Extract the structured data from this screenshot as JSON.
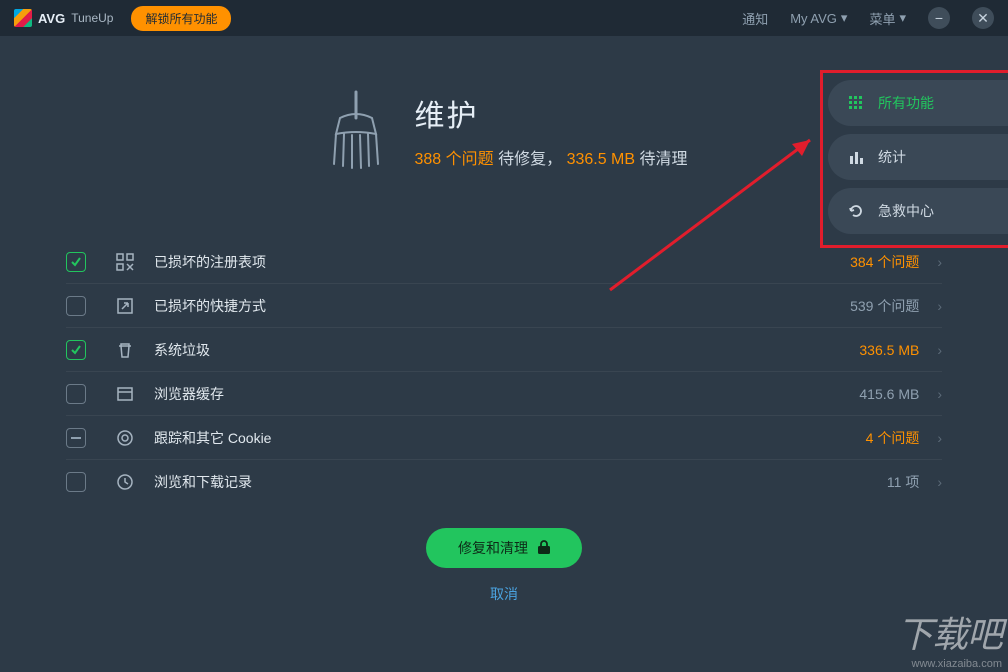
{
  "titlebar": {
    "brand": "AVG",
    "product": "TuneUp",
    "unlock": "解锁所有功能",
    "notify": "通知",
    "myavg": "My AVG",
    "menu": "菜单"
  },
  "hero": {
    "title": "维护",
    "count": "388",
    "count_suffix": "个问题",
    "text1": "待修复，",
    "size": "336.5 MB",
    "text2": "待清理"
  },
  "panel": {
    "all_features": "所有功能",
    "stats": "统计",
    "rescue": "急救中心"
  },
  "rows": [
    {
      "checked": "on",
      "icon": "registry",
      "label": "已损坏的注册表项",
      "val": "384 个问题",
      "hi": true
    },
    {
      "checked": "",
      "icon": "shortcut",
      "label": "已损坏的快捷方式",
      "val": "539 个问题",
      "hi": false
    },
    {
      "checked": "on",
      "icon": "trash",
      "label": "系统垃圾",
      "val": "336.5 MB",
      "hi": true
    },
    {
      "checked": "",
      "icon": "browser",
      "label": "浏览器缓存",
      "val": "415.6 MB",
      "hi": false
    },
    {
      "checked": "partial",
      "icon": "cookie",
      "label": "跟踪和其它 Cookie",
      "val": "4 个问题",
      "hi": true
    },
    {
      "checked": "",
      "icon": "history",
      "label": "浏览和下载记录",
      "val": "11 项",
      "hi": false
    }
  ],
  "footer": {
    "fix": "修复和清理",
    "cancel": "取消"
  },
  "watermark": {
    "big": "下载吧",
    "url": "www.xiazaiba.com"
  }
}
